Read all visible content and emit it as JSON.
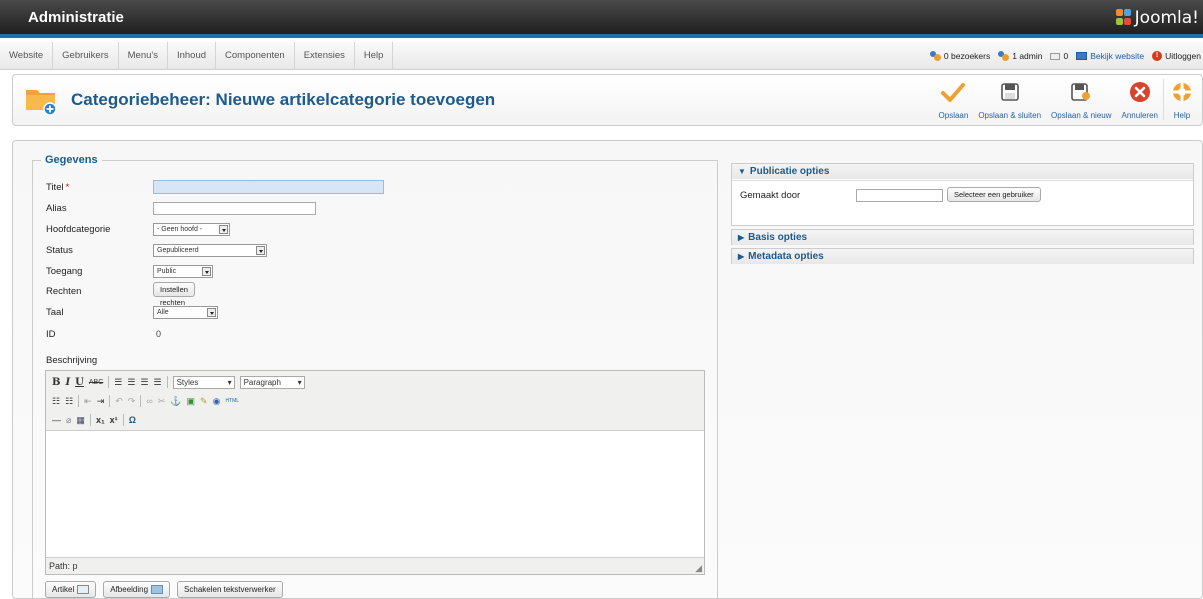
{
  "header": {
    "title": "Administratie",
    "logo_text": "Joomla!"
  },
  "menu": {
    "items": [
      "Website",
      "Gebruikers",
      "Menu's",
      "Inhoud",
      "Componenten",
      "Extensies",
      "Help"
    ]
  },
  "status": {
    "visitors": "0 bezoekers",
    "admins": "1 admin",
    "messages": "0",
    "view_site": "Bekijk website",
    "logout": "Uitloggen"
  },
  "toolbar": {
    "title": "Categoriebeheer: Nieuwe artikelcategorie toevoegen",
    "buttons": {
      "save": "Opslaan",
      "save_close": "Opslaan & sluiten",
      "save_new": "Opslaan & nieuw",
      "cancel": "Annuleren",
      "help": "Help"
    }
  },
  "form": {
    "legend": "Gegevens",
    "title_label": "Titel",
    "title_required": "*",
    "title_value": "",
    "alias_label": "Alias",
    "alias_value": "",
    "parent_label": "Hoofdcategorie",
    "parent_value": "- Geen hoofd -",
    "status_label": "Status",
    "status_value": "Gepubliceerd",
    "access_label": "Toegang",
    "access_value": "Public",
    "rights_label": "Rechten",
    "rights_button": "Instellen rechten",
    "language_label": "Taal",
    "language_value": "Alle",
    "id_label": "ID",
    "id_value": "0",
    "description_label": "Beschrijving"
  },
  "editor": {
    "styles_value": "Styles",
    "format_value": "Paragraph",
    "html_label": "HTML",
    "path": "Path: p"
  },
  "bottom_buttons": {
    "article": "Artikel",
    "image": "Afbeelding",
    "toggle": "Schakelen tekstverwerker"
  },
  "panels": {
    "publishing": {
      "title": "Publicatie opties",
      "created_by_label": "Gemaakt door",
      "created_by_value": "",
      "select_user_button": "Selecteer een gebruiker"
    },
    "basic": {
      "title": "Basis opties"
    },
    "metadata": {
      "title": "Metadata opties"
    }
  },
  "colors": {
    "header_accent": "#1a6fb0",
    "title_blue": "#1e5a8c",
    "save_orange": "#f0a030",
    "cancel_red": "#d9432e"
  }
}
